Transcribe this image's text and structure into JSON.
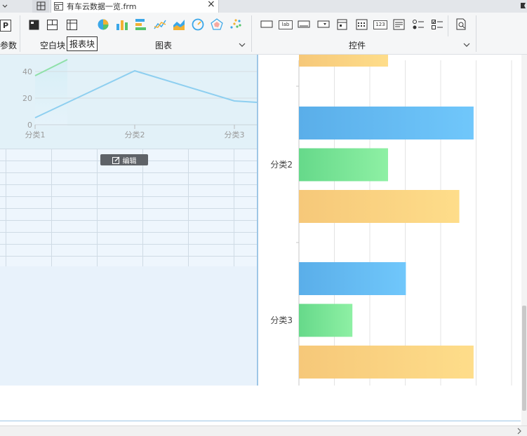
{
  "tabs": {
    "file_name": "有车云数据一览.frm",
    "close_glyph": "×"
  },
  "toolbar": {
    "param_label": "参数",
    "blank_block_label": "空白块",
    "report_block_label": "报表块",
    "charts_group_label": "图表",
    "widgets_group_label": "控件",
    "widget_text_icons": [
      "lab",
      "123"
    ]
  },
  "left_chart": {
    "y_ticks": [
      "40",
      "20",
      "0"
    ],
    "categories": [
      "分类1",
      "分类2",
      "分类3"
    ],
    "edit_label": "编辑"
  },
  "chart_data": {
    "type": "bar",
    "orientation": "horizontal",
    "categories": [
      "分类2",
      "分类3"
    ],
    "series": [
      {
        "color": "#64b5f6",
        "values": [
          49,
          30
        ]
      },
      {
        "color": "#7ee39a",
        "values": [
          25,
          15
        ]
      },
      {
        "color": "#fbd07a",
        "values": [
          45,
          49
        ]
      }
    ],
    "partial_top_value": 25,
    "xlim": [
      0,
      63
    ],
    "grid": true
  },
  "colors": {
    "accent": "#5b9bd5",
    "bar_blue": "#64b5f6",
    "bar_green": "#7ee39a",
    "bar_orange": "#fbd07a"
  }
}
